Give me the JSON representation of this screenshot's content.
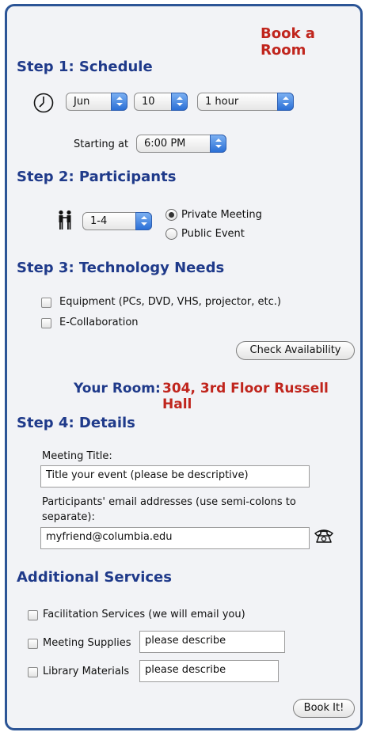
{
  "header": {
    "title": "Book a Room"
  },
  "step1": {
    "heading": "Step 1: Schedule",
    "month": "Jun",
    "day": "10",
    "duration": "1 hour",
    "start_label": "Starting at",
    "start_time": "6:00 PM"
  },
  "step2": {
    "heading": "Step 2: Participants",
    "count": "1-4",
    "options": [
      "Private Meeting",
      "Public Event"
    ],
    "selected": "Private Meeting"
  },
  "step3": {
    "heading": "Step 3: Technology Needs",
    "options": [
      "Equipment (PCs, DVD, VHS, projector, etc.)",
      "E-Collaboration"
    ],
    "check_button": "Check Availability"
  },
  "room": {
    "label": "Your Room:",
    "value": "304, 3rd Floor Russell Hall"
  },
  "step4": {
    "heading": "Step 4: Details",
    "meeting_title_label": "Meeting Title:",
    "meeting_title_value": "Title your event (please be descriptive)",
    "emails_label": "Participants' email addresses (use semi-colons to separate):",
    "emails_value": "myfriend@columbia.edu"
  },
  "services": {
    "heading": "Additional Services",
    "facilitation": "Facilitation Services (we will email you)",
    "supplies_label": "Meeting Supplies",
    "supplies_value": "please describe",
    "library_label": "Library Materials",
    "library_value": "please describe"
  },
  "submit": {
    "label": "Book It!"
  },
  "icons": {
    "clock": "clock-icon",
    "people": "people-icon",
    "phone": "phone-icon"
  },
  "colors": {
    "heading": "#1f3a8a",
    "accent": "#c0251d",
    "border": "#2c5596",
    "select_arrow": "#2b6fd6"
  }
}
